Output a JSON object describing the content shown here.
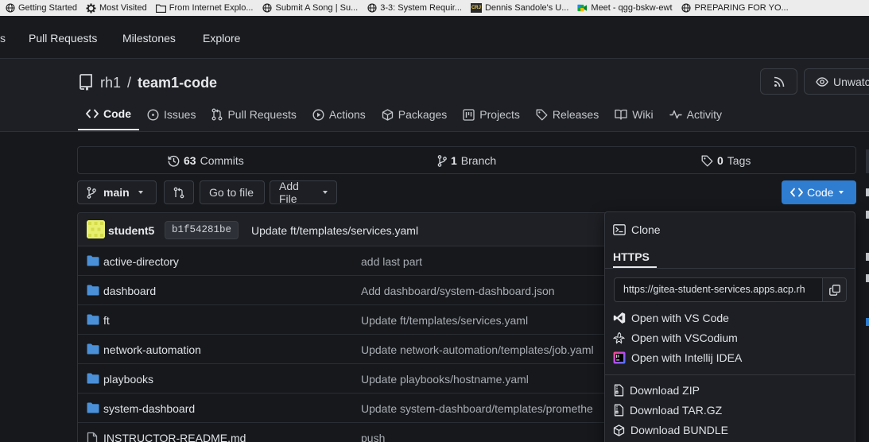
{
  "bookmarks": [
    {
      "label": "Getting Started",
      "icon": "globe-icon"
    },
    {
      "label": "Most Visited",
      "icon": "gear-icon"
    },
    {
      "label": "From Internet Explo...",
      "icon": "folder-icon"
    },
    {
      "label": "Submit A Song | Su...",
      "icon": "globe-icon"
    },
    {
      "label": "3-3: System Requir...",
      "icon": "globe-icon"
    },
    {
      "label": "Dennis Sandole's U...",
      "icon": "crj-logo-icon"
    },
    {
      "label": "Meet - qgg-bskw-ewt",
      "icon": "meet-icon"
    },
    {
      "label": "PREPARING FOR YO...",
      "icon": "globe-icon"
    }
  ],
  "topnav": {
    "fragment": "s",
    "links": [
      "Pull Requests",
      "Milestones",
      "Explore"
    ]
  },
  "repo": {
    "owner": "rh1",
    "separator": "/",
    "name": "team1-code",
    "watch_label": "Unwatch"
  },
  "tabs": [
    {
      "label": "Code",
      "icon": "code-icon",
      "active": true
    },
    {
      "label": "Issues",
      "icon": "issue-icon"
    },
    {
      "label": "Pull Requests",
      "icon": "pull-request-icon"
    },
    {
      "label": "Actions",
      "icon": "play-icon"
    },
    {
      "label": "Packages",
      "icon": "package-icon"
    },
    {
      "label": "Projects",
      "icon": "project-icon"
    },
    {
      "label": "Releases",
      "icon": "tag-icon"
    },
    {
      "label": "Wiki",
      "icon": "book-icon"
    },
    {
      "label": "Activity",
      "icon": "pulse-icon"
    }
  ],
  "stats": {
    "commits_count": "63",
    "commits_label": "Commits",
    "branch_count": "1",
    "branch_label": "Branch",
    "tags_count": "0",
    "tags_label": "Tags"
  },
  "toolbar": {
    "branch": "main",
    "go_to_file": "Go to file",
    "add_file": "Add File",
    "code": "Code"
  },
  "latest_commit": {
    "author": "student5",
    "sha": "b1f54281be",
    "message": "Update ft/templates/services.yaml"
  },
  "files": [
    {
      "name": "active-directory",
      "commit": "add last part",
      "type": "folder"
    },
    {
      "name": "dashboard",
      "commit": "Add dashboard/system-dashboard.json",
      "type": "folder"
    },
    {
      "name": "ft",
      "commit": "Update ft/templates/services.yaml",
      "type": "folder"
    },
    {
      "name": "network-automation",
      "commit": "Update network-automation/templates/job.yaml",
      "type": "folder"
    },
    {
      "name": "playbooks",
      "commit": "Update playbooks/hostname.yaml",
      "type": "folder"
    },
    {
      "name": "system-dashboard",
      "commit": "Update system-dashboard/templates/promethe",
      "type": "folder"
    },
    {
      "name": "INSTRUCTOR-README.md",
      "commit": "push",
      "type": "file"
    }
  ],
  "clone": {
    "title": "Clone",
    "protocol": "HTTPS",
    "url": "https://gitea-student-services.apps.acp.rh",
    "open_options": [
      {
        "label": "Open with VS Code",
        "icon": "vscode-icon"
      },
      {
        "label": "Open with VSCodium",
        "icon": "vscodium-icon"
      },
      {
        "label": "Open with Intellij IDEA",
        "icon": "intellij-icon"
      }
    ],
    "downloads": [
      {
        "label": "Download ZIP",
        "icon": "file-zip-icon"
      },
      {
        "label": "Download TAR.GZ",
        "icon": "file-zip-icon"
      },
      {
        "label": "Download BUNDLE",
        "icon": "package-icon"
      }
    ]
  },
  "colors": {
    "primary_button": "#2f7dd1",
    "folder": "#4a90d9",
    "background": "#16181c"
  }
}
